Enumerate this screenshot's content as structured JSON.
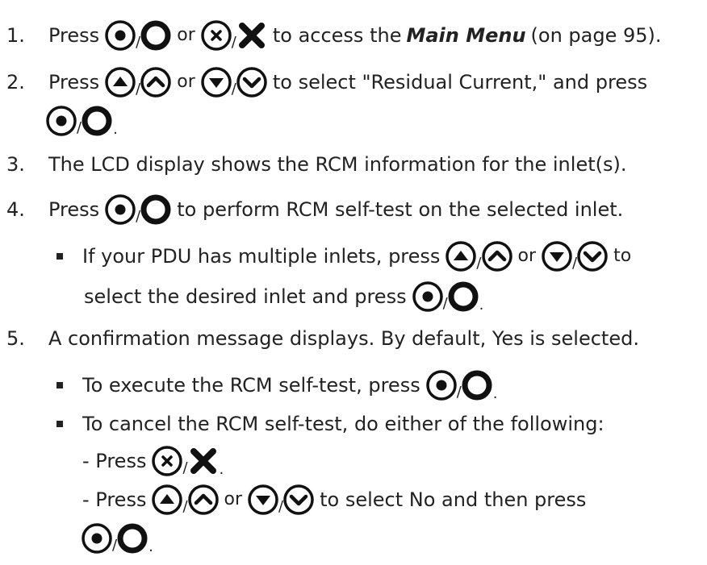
{
  "steps": [
    {
      "num": "1.",
      "press": "Press",
      "or": "or",
      "access_prefix": "to access the",
      "main_menu": "Main Menu",
      "page_ref": "(on page 95)."
    },
    {
      "num": "2.",
      "press": "Press",
      "or": "or",
      "text": "to select \"Residual Current,\" and press",
      "end": "."
    },
    {
      "num": "3.",
      "text": "The LCD display shows the RCM information for the inlet(s)."
    },
    {
      "num": "4.",
      "press": "Press",
      "text": "to perform RCM self-test on the selected inlet.",
      "sub": {
        "prefix": "If your PDU has multiple inlets, press",
        "or": "or",
        "to": "to",
        "line2": "select the desired inlet and press",
        "end": "."
      }
    },
    {
      "num": "5.",
      "text": "A confirmation message displays. By default, Yes is selected.",
      "sub1": {
        "text": "To execute the RCM self-test, press",
        "end": "."
      },
      "sub2": {
        "text": "To cancel the RCM self-test, do either of the following:"
      },
      "dash1": {
        "press": "- Press",
        "end": "."
      },
      "dash2": {
        "press": "- Press",
        "or": "or",
        "text": "to select No and then press",
        "end": "."
      }
    }
  ],
  "slash": "/",
  "icons": [
    "select-button-icon",
    "select-key-icon",
    "cancel-button-icon",
    "cancel-key-icon",
    "up-button-icon",
    "up-key-icon",
    "down-button-icon",
    "down-key-icon"
  ]
}
